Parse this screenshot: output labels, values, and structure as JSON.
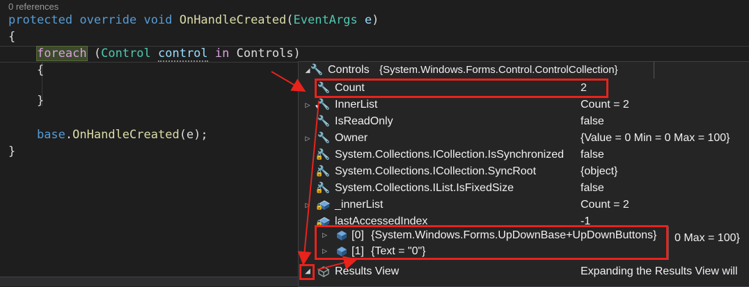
{
  "editor": {
    "codelens": "0 references",
    "lines": {
      "l1_kw1": "protected",
      "l1_kw2": "override",
      "l1_kw3": "void",
      "l1_method": "OnHandleCreated",
      "l1_paren_open": "(",
      "l1_type": "EventArgs",
      "l1_param": "e",
      "l1_paren_close": ")",
      "l2": "{",
      "l3_foreach": "foreach",
      "l3_open": " (",
      "l3_type": "Control",
      "l3_var": "control",
      "l3_in": "in",
      "l3_rest": "Controls)",
      "l4": "{",
      "l6": "}",
      "l8_base": "base",
      "l8_dot": ".",
      "l8_method": "OnHandleCreated",
      "l8_rest": "(e);",
      "l9": "}"
    }
  },
  "datatip": {
    "header": {
      "name": "Controls",
      "value": "{System.Windows.Forms.Control.ControlCollection}"
    },
    "rows": [
      {
        "expander": "",
        "icon": "wrench-icon",
        "name": "Count",
        "value": "2"
      },
      {
        "expander": "▷",
        "icon": "wrench-heart-icon",
        "name": "InnerList",
        "value": "Count = 2"
      },
      {
        "expander": "",
        "icon": "wrench-icon",
        "name": "IsReadOnly",
        "value": "false"
      },
      {
        "expander": "▷",
        "icon": "wrench-icon",
        "name": "Owner",
        "value": "{Value = 0 Min = 0 Max = 100}"
      },
      {
        "expander": "",
        "icon": "locked-wrench-icon",
        "name": "System.Collections.ICollection.IsSynchronized",
        "value": "false"
      },
      {
        "expander": "",
        "icon": "locked-wrench-icon",
        "name": "System.Collections.ICollection.SyncRoot",
        "value": "{object}"
      },
      {
        "expander": "",
        "icon": "locked-wrench-icon",
        "name": "System.Collections.IList.IsFixedSize",
        "value": "false"
      },
      {
        "expander": "▷",
        "icon": "locked-field-icon",
        "name": "_innerList",
        "value": "Count = 2"
      },
      {
        "expander": "",
        "icon": "locked-field-icon",
        "name": "lastAccessedIndex",
        "value": "-1"
      },
      {
        "expander": "",
        "icon": "",
        "name": "",
        "value": "0 Max = 100}"
      },
      {
        "expander": "◢",
        "icon": "results-view-icon",
        "name": "Results View",
        "value": "Expanding the Results View will"
      }
    ],
    "children": [
      {
        "index": "[0]",
        "value": "{System.Windows.Forms.UpDownBase+UpDownButtons}"
      },
      {
        "index": "[1]",
        "value": "{Text = \"0\"}"
      }
    ]
  },
  "colors": {
    "annotation_red": "#e8231c",
    "editor_bg": "#1e1e1e",
    "datatip_bg": "#252526"
  }
}
